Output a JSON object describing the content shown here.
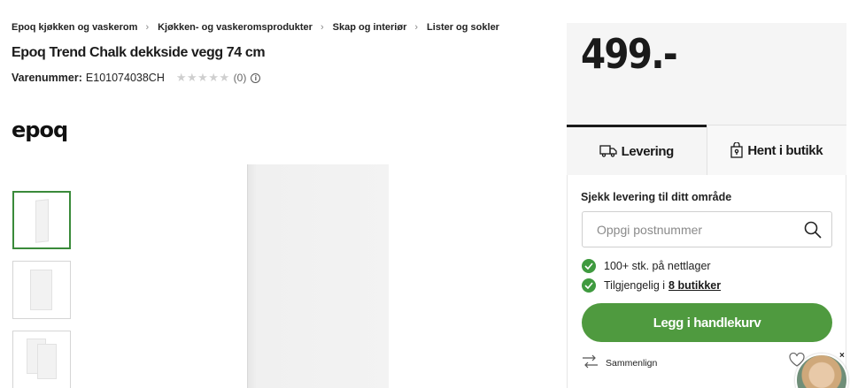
{
  "breadcrumb": [
    "Epoq kjøkken og vaskerom",
    "Kjøkken- og vaskeromsprodukter",
    "Skap og interiør",
    "Lister og sokler"
  ],
  "product": {
    "title": "Epoq Trend Chalk dekkside vegg 74 cm",
    "sku_label": "Varenummer:",
    "sku_value": "E101074038CH",
    "stars": "★★★★★",
    "rating_count": "(0)",
    "info_icon": "i"
  },
  "brand": "epoq",
  "thumbnails": [
    "thumb-1",
    "thumb-2",
    "thumb-3"
  ],
  "price": "499.-",
  "tabs": [
    {
      "label": "Levering",
      "icon": "truck-icon",
      "active": true
    },
    {
      "label": "Hent i butikk",
      "icon": "store-bag-icon",
      "active": false
    }
  ],
  "delivery": {
    "check_label": "Sjekk levering til ditt område",
    "postal_placeholder": "Oppgi postnummer",
    "stock_online": "100+ stk. på nettlager",
    "available_prefix": "Tilgjengelig i",
    "available_link": "8 butikker",
    "add_to_cart": "Legg i handlekurv",
    "compare": "Sammenlign"
  },
  "chat": {
    "close": "×"
  },
  "colors": {
    "accent_green": "#4f9a3f",
    "check_green": "#3f9a3f",
    "panel_bg": "#f5f5f5"
  }
}
